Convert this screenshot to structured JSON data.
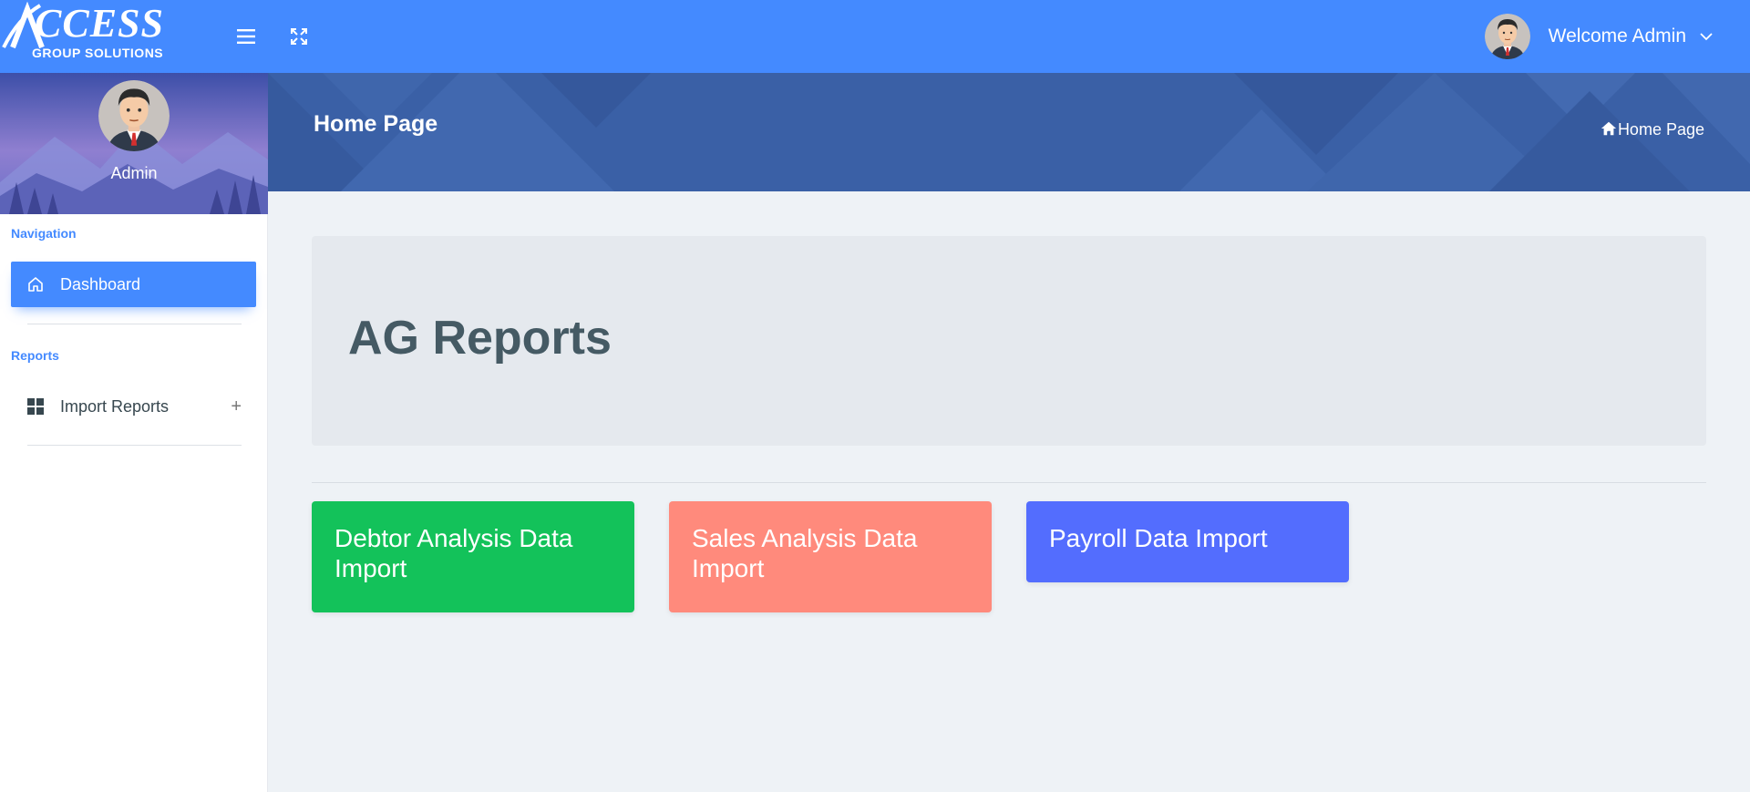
{
  "brand": {
    "logo_main": "CCESS",
    "logo_sub": "GROUP SOLUTIONS"
  },
  "header": {
    "welcome_text": "Welcome Admin",
    "menu_icon": "hamburger-icon",
    "fullscreen_icon": "expand-icon",
    "dropdown_icon": "chevron-down-icon"
  },
  "sidebar": {
    "profile_name": "Admin",
    "sections": [
      {
        "caption": "Navigation",
        "items": [
          {
            "label": "Dashboard",
            "icon": "home-icon",
            "active": true
          }
        ]
      },
      {
        "caption": "Reports",
        "items": [
          {
            "label": "Import Reports",
            "icon": "grid-icon",
            "expand": "+"
          }
        ]
      }
    ]
  },
  "page": {
    "title": "Home Page",
    "breadcrumb": [
      "Home Page"
    ]
  },
  "main": {
    "heading": "AG Reports",
    "tiles": [
      {
        "label": "Debtor Analysis Data Import",
        "color": "#13c25a"
      },
      {
        "label": "Sales Analysis Data Import",
        "color": "#ff8a7c"
      },
      {
        "label": "Payroll Data Import",
        "color": "#536dfe"
      }
    ]
  },
  "colors": {
    "primary": "#448aff",
    "header_band": "#3d63a8"
  }
}
